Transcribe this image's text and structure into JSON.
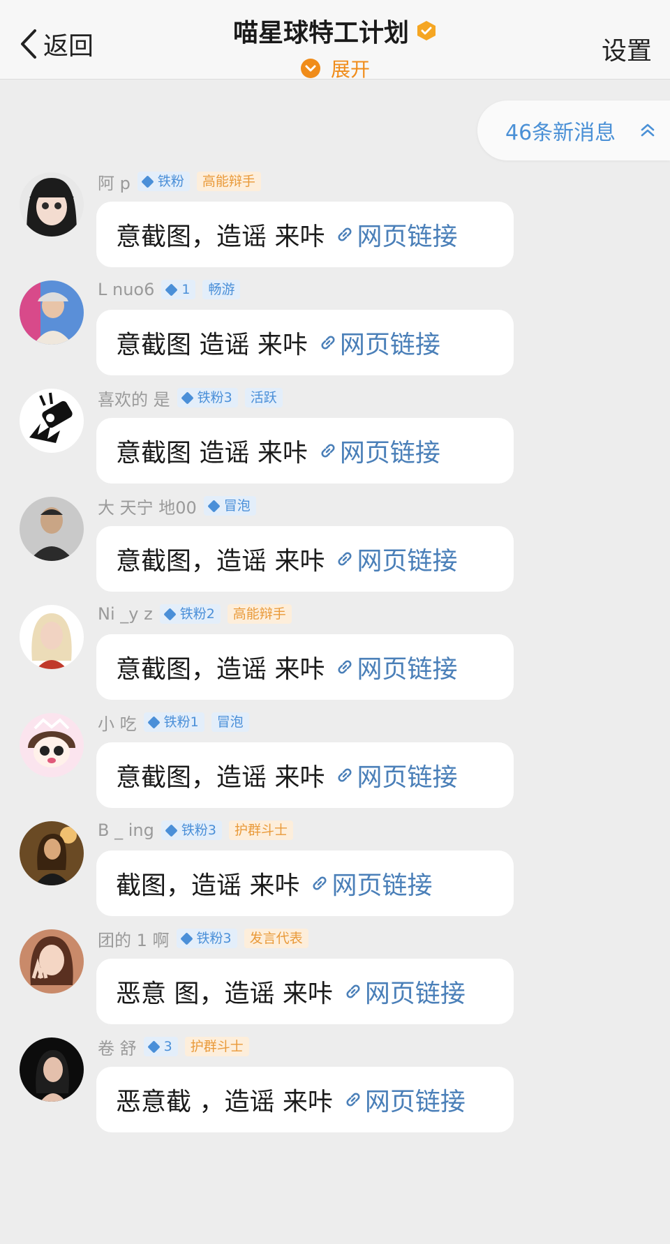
{
  "header": {
    "back_label": "返回",
    "title": "喵星球特工计划",
    "expand_label": "展开",
    "settings_label": "设置"
  },
  "new_messages": {
    "label": "46条新消息"
  },
  "colors": {
    "accent_orange": "#f08c1a",
    "link_blue": "#4a7fb8",
    "badge_blue": "#4a8fd8",
    "badge_orange": "#e99a3a",
    "background": "#ededed"
  },
  "messages": [
    {
      "nickname": "",
      "badges": [],
      "text": "意截图，造谣 来咔",
      "link": "网页链接",
      "avatar_icon": "avatar-partial-icon"
    },
    {
      "nickname": "阿 p",
      "badges": [
        {
          "label": "铁粉",
          "style": "blue"
        },
        {
          "label": "高能辩手",
          "style": "orange"
        }
      ],
      "text": "意截图，造谣 来咔",
      "link": "网页链接",
      "avatar_icon": "avatar-anime-girl-icon"
    },
    {
      "nickname": "L nuo6",
      "badges": [
        {
          "label": "1",
          "style": "blue"
        },
        {
          "label": "畅游",
          "style": "blue"
        }
      ],
      "text": "意截图 造谣 来咔",
      "link": "网页链接",
      "avatar_icon": "avatar-man-cap-icon"
    },
    {
      "nickname": "喜欢的 是",
      "badges": [
        {
          "label": "铁粉3",
          "style": "blue"
        },
        {
          "label": "活跃",
          "style": "blue"
        }
      ],
      "text": "意截图 造谣 来咔",
      "link": "网页链接",
      "avatar_icon": "avatar-cartoon-icon"
    },
    {
      "nickname": "大 天宁 地00",
      "badges": [
        {
          "label": "冒泡",
          "style": "blue"
        }
      ],
      "text": "意截图，造谣 来咔",
      "link": "网页链接",
      "avatar_icon": "avatar-older-man-icon"
    },
    {
      "nickname": "Ni _y z",
      "badges": [
        {
          "label": "铁粉2",
          "style": "blue"
        },
        {
          "label": "高能辩手",
          "style": "orange"
        }
      ],
      "text": "意截图，造谣 来咔",
      "link": "网页链接",
      "avatar_icon": "avatar-blonde-woman-icon"
    },
    {
      "nickname": "小 吃",
      "badges": [
        {
          "label": "铁粉1",
          "style": "blue"
        },
        {
          "label": "冒泡",
          "style": "blue"
        }
      ],
      "text": "意截图，造谣 来咔",
      "link": "网页链接",
      "avatar_icon": "avatar-chibi-icon"
    },
    {
      "nickname": "B _ ing",
      "badges": [
        {
          "label": "铁粉3",
          "style": "blue"
        },
        {
          "label": "护群斗士",
          "style": "orange"
        }
      ],
      "text": "截图，造谣 来咔",
      "link": "网页链接",
      "avatar_icon": "avatar-woman-dark-icon"
    },
    {
      "nickname": "团的 1 啊",
      "badges": [
        {
          "label": "铁粉3",
          "style": "blue"
        },
        {
          "label": "发言代表",
          "style": "orange"
        }
      ],
      "text": "恶意 图，造谣 来咔",
      "link": "网页链接",
      "avatar_icon": "avatar-woman-peace-icon"
    },
    {
      "nickname": "卷 舒",
      "badges": [
        {
          "label": "3",
          "style": "blue"
        },
        {
          "label": "护群斗士",
          "style": "orange"
        }
      ],
      "text": "恶意截 ，造谣 来咔",
      "link": "网页链接",
      "avatar_icon": "avatar-woman-black-icon"
    }
  ]
}
